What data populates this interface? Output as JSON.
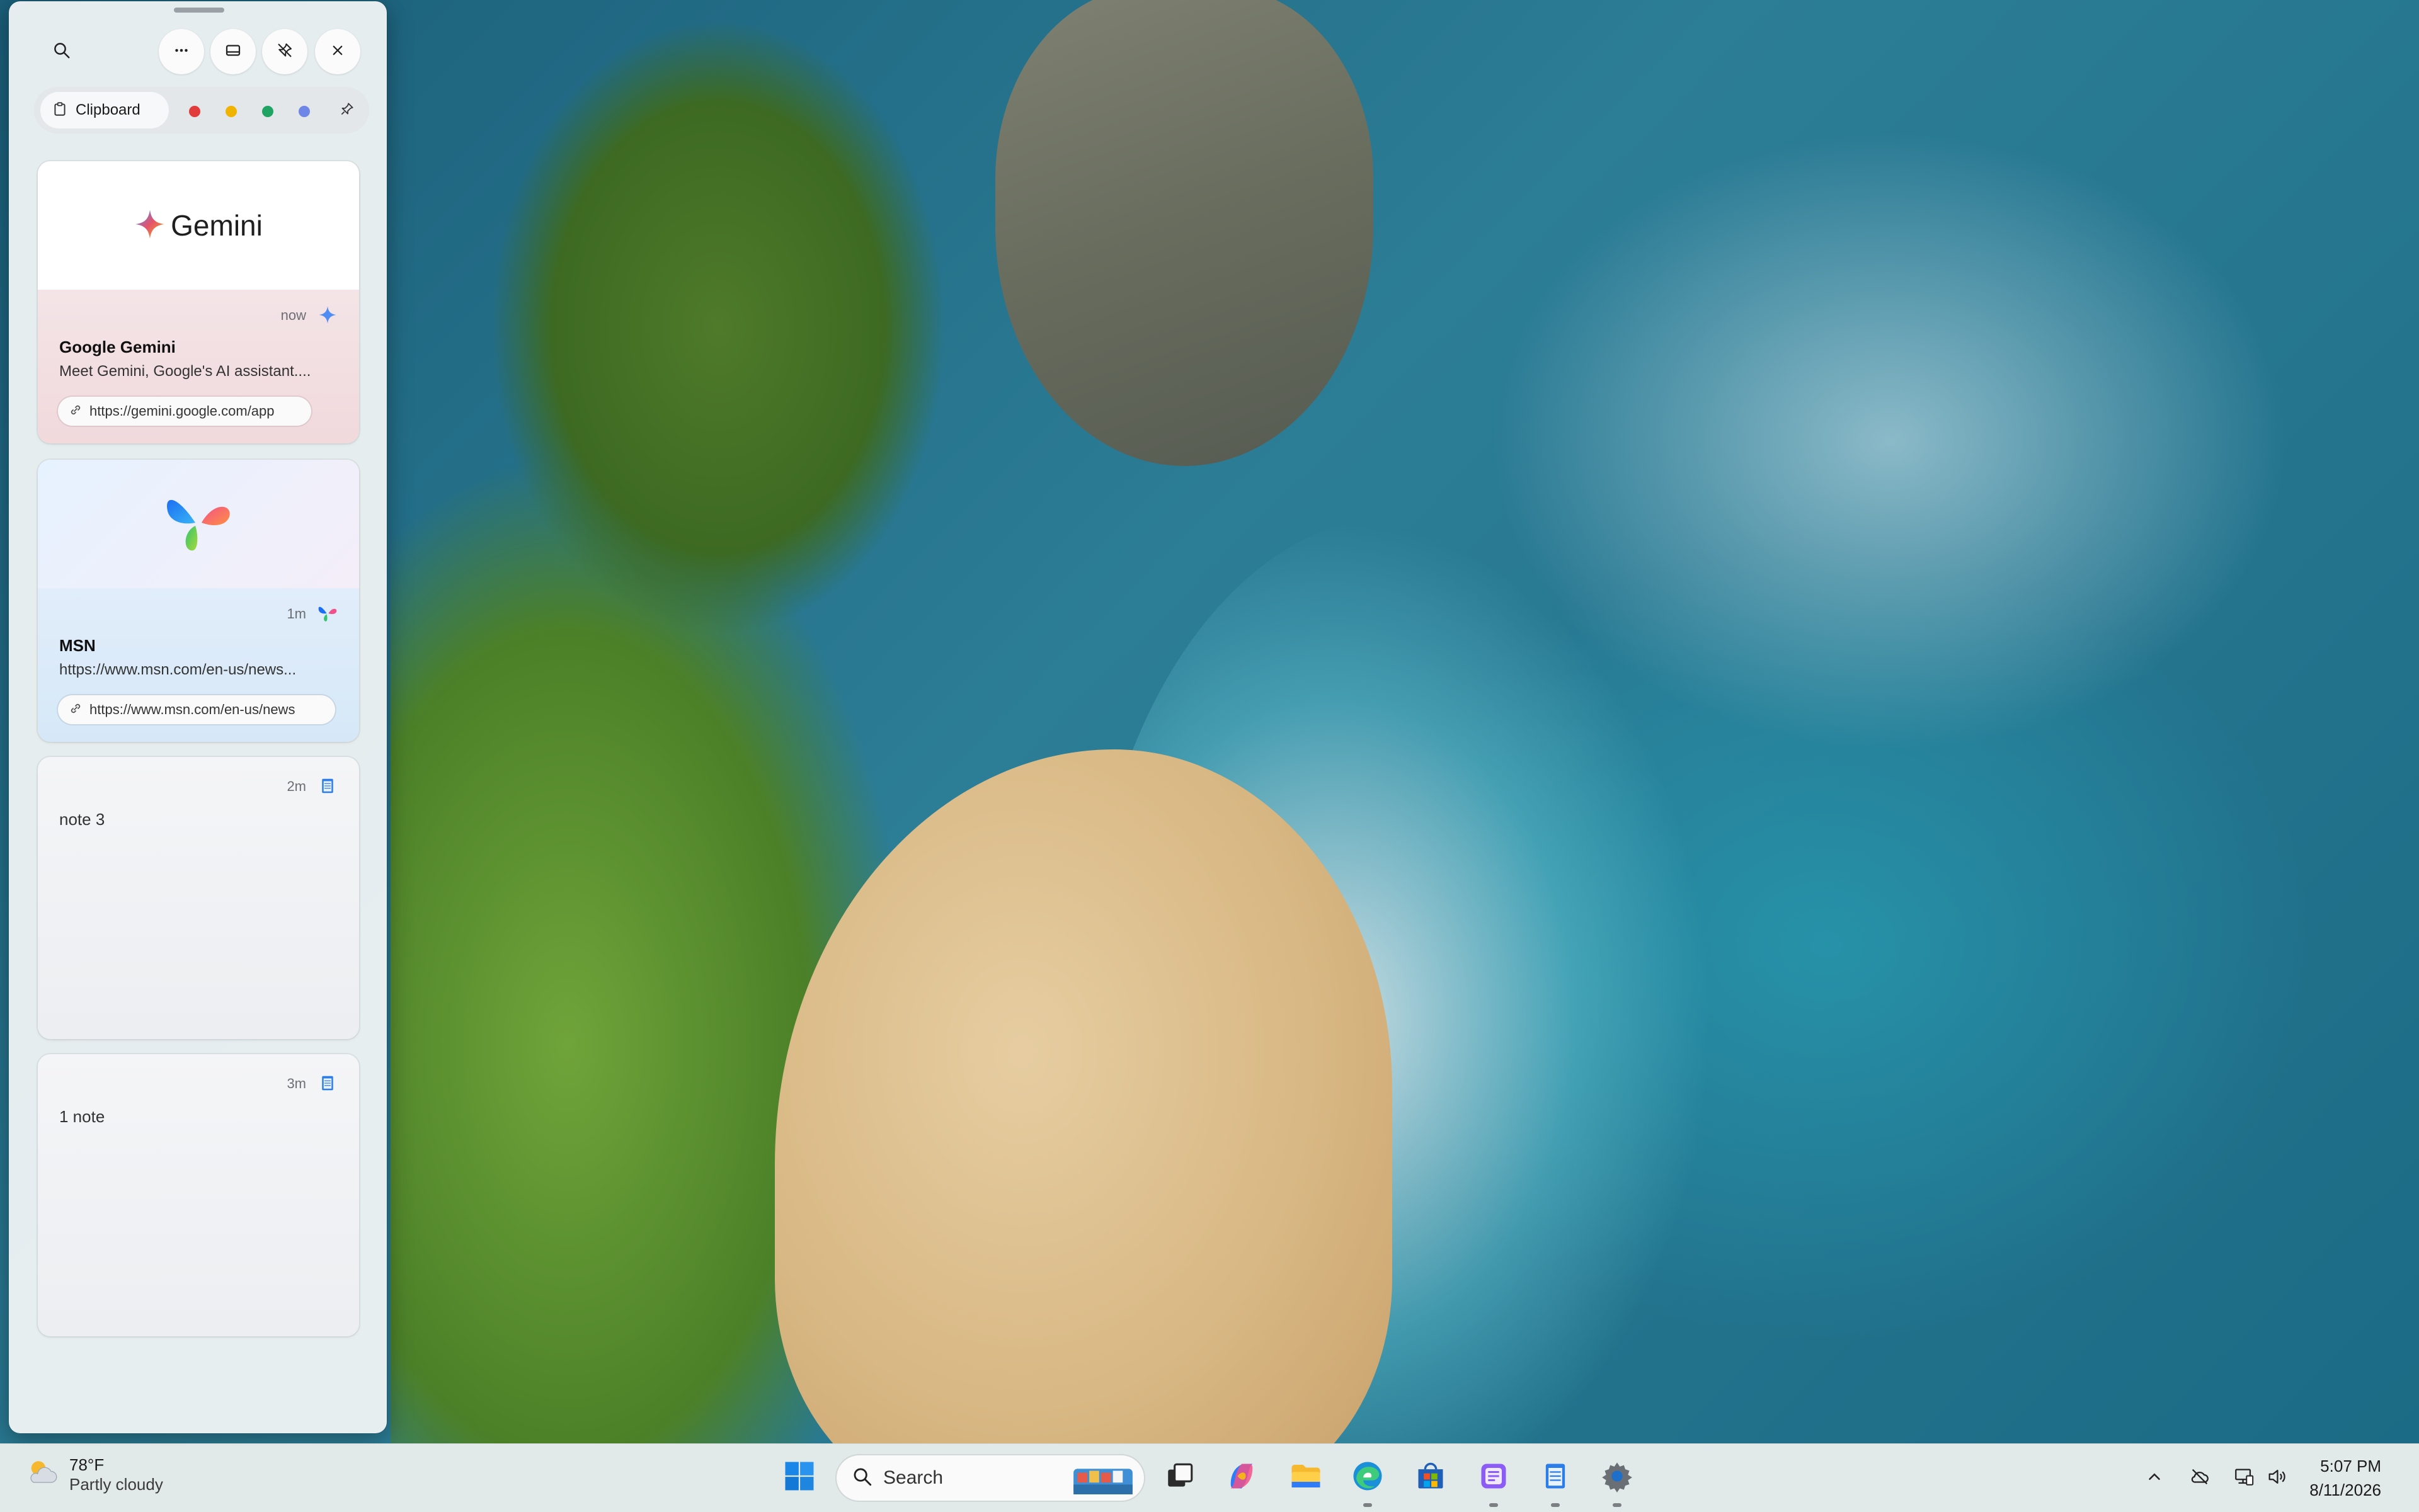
{
  "clipboard_panel": {
    "tab_label": "Clipboard",
    "color_filters": [
      {
        "name": "red",
        "color": "#e23b3b"
      },
      {
        "name": "yellow",
        "color": "#f0b400"
      },
      {
        "name": "green",
        "color": "#1fa463"
      },
      {
        "name": "blue",
        "color": "#6e86e6"
      }
    ],
    "items": [
      {
        "type": "link",
        "hero_text": "Gemini",
        "time": "now",
        "title": "Google Gemini",
        "description": "Meet Gemini, Google's AI assistant....",
        "url": "https://gemini.google.com/app"
      },
      {
        "type": "link",
        "time": "1m",
        "title": "MSN",
        "description": "https://www.msn.com/en-us/news...",
        "url": "https://www.msn.com/en-us/news"
      },
      {
        "type": "note",
        "time": "2m",
        "text": "note 3"
      },
      {
        "type": "note",
        "time": "3m",
        "text": "1 note"
      }
    ]
  },
  "taskbar": {
    "weather": {
      "temp": "78°F",
      "condition": "Partly cloudy"
    },
    "search_placeholder": "Search",
    "clock": {
      "time": "5:07 PM",
      "date": "8/11/2026"
    },
    "apps": [
      "start-icon",
      "task-view-icon",
      "copilot-icon",
      "file-explorer-icon",
      "edge-icon",
      "store-icon",
      "notes-app-icon",
      "notepad-icon",
      "settings-icon"
    ]
  }
}
